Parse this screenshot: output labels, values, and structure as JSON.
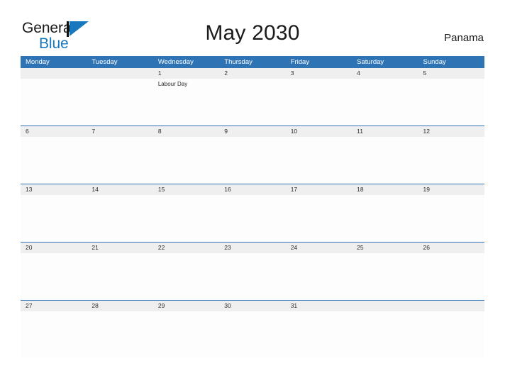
{
  "brand": {
    "name_part1": "General",
    "name_part2": "Blue",
    "mark": "triangle-flag-icon",
    "accent_color": "#1878be"
  },
  "header": {
    "title": "May 2030",
    "country": "Panama"
  },
  "colors": {
    "header_blue": "#2e74b5",
    "row_band": "#efefef",
    "cell_bg": "#fdfdfd",
    "text": "#2b2b2b"
  },
  "calendar": {
    "month": "May",
    "year": "2030",
    "weekday_headers": [
      "Monday",
      "Tuesday",
      "Wednesday",
      "Thursday",
      "Friday",
      "Saturday",
      "Sunday"
    ],
    "weeks": [
      [
        {
          "date": "",
          "events": []
        },
        {
          "date": "",
          "events": []
        },
        {
          "date": "1",
          "events": [
            "Labour Day"
          ]
        },
        {
          "date": "2",
          "events": []
        },
        {
          "date": "3",
          "events": []
        },
        {
          "date": "4",
          "events": []
        },
        {
          "date": "5",
          "events": []
        }
      ],
      [
        {
          "date": "6",
          "events": []
        },
        {
          "date": "7",
          "events": []
        },
        {
          "date": "8",
          "events": []
        },
        {
          "date": "9",
          "events": []
        },
        {
          "date": "10",
          "events": []
        },
        {
          "date": "11",
          "events": []
        },
        {
          "date": "12",
          "events": []
        }
      ],
      [
        {
          "date": "13",
          "events": []
        },
        {
          "date": "14",
          "events": []
        },
        {
          "date": "15",
          "events": []
        },
        {
          "date": "16",
          "events": []
        },
        {
          "date": "17",
          "events": []
        },
        {
          "date": "18",
          "events": []
        },
        {
          "date": "19",
          "events": []
        }
      ],
      [
        {
          "date": "20",
          "events": []
        },
        {
          "date": "21",
          "events": []
        },
        {
          "date": "22",
          "events": []
        },
        {
          "date": "23",
          "events": []
        },
        {
          "date": "24",
          "events": []
        },
        {
          "date": "25",
          "events": []
        },
        {
          "date": "26",
          "events": []
        }
      ],
      [
        {
          "date": "27",
          "events": []
        },
        {
          "date": "28",
          "events": []
        },
        {
          "date": "29",
          "events": []
        },
        {
          "date": "30",
          "events": []
        },
        {
          "date": "31",
          "events": []
        },
        {
          "date": "",
          "events": []
        },
        {
          "date": "",
          "events": []
        }
      ]
    ]
  }
}
